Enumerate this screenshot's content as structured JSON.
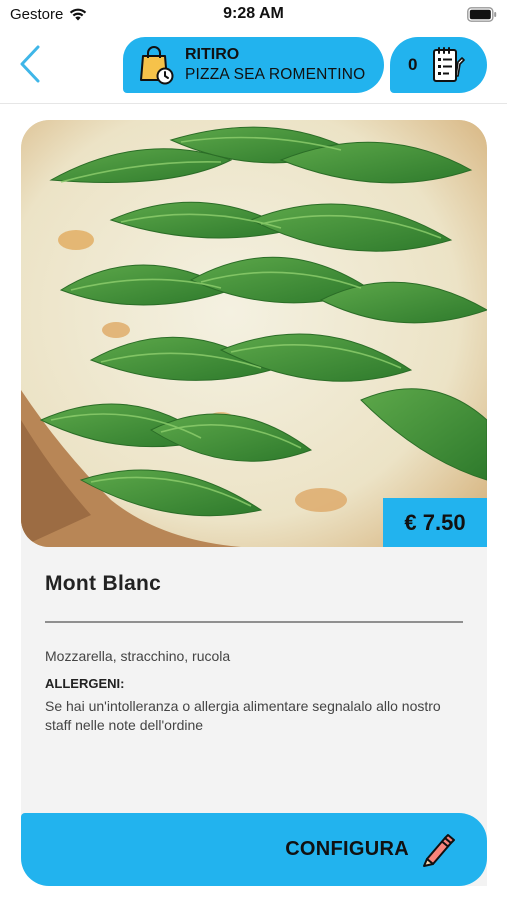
{
  "status_bar": {
    "carrier": "Gestore",
    "time": "9:28 AM"
  },
  "header": {
    "back_icon": "chevron-left-icon",
    "pickup": {
      "label": "RITIRO",
      "store": "PIZZA SEA ROMENTINO",
      "icon": "shopping-bag-clock-icon"
    },
    "cart": {
      "count": "0",
      "icon": "order-list-icon"
    }
  },
  "product": {
    "image": "pizza-rucola-photo",
    "price": "€ 7.50",
    "name": "Mont Blanc",
    "ingredients": "Mozzarella, stracchino, rucola",
    "allergens_title": "ALLERGENI:",
    "allergens_text": "Se hai un'intolleranza o allergia alimentare segnalalo allo nostro staff nelle note dell'ordine"
  },
  "action": {
    "label": "CONFIGURA",
    "icon": "pencil-icon"
  },
  "colors": {
    "accent": "#22b3ee",
    "back_arrow": "#3fb6e8"
  }
}
